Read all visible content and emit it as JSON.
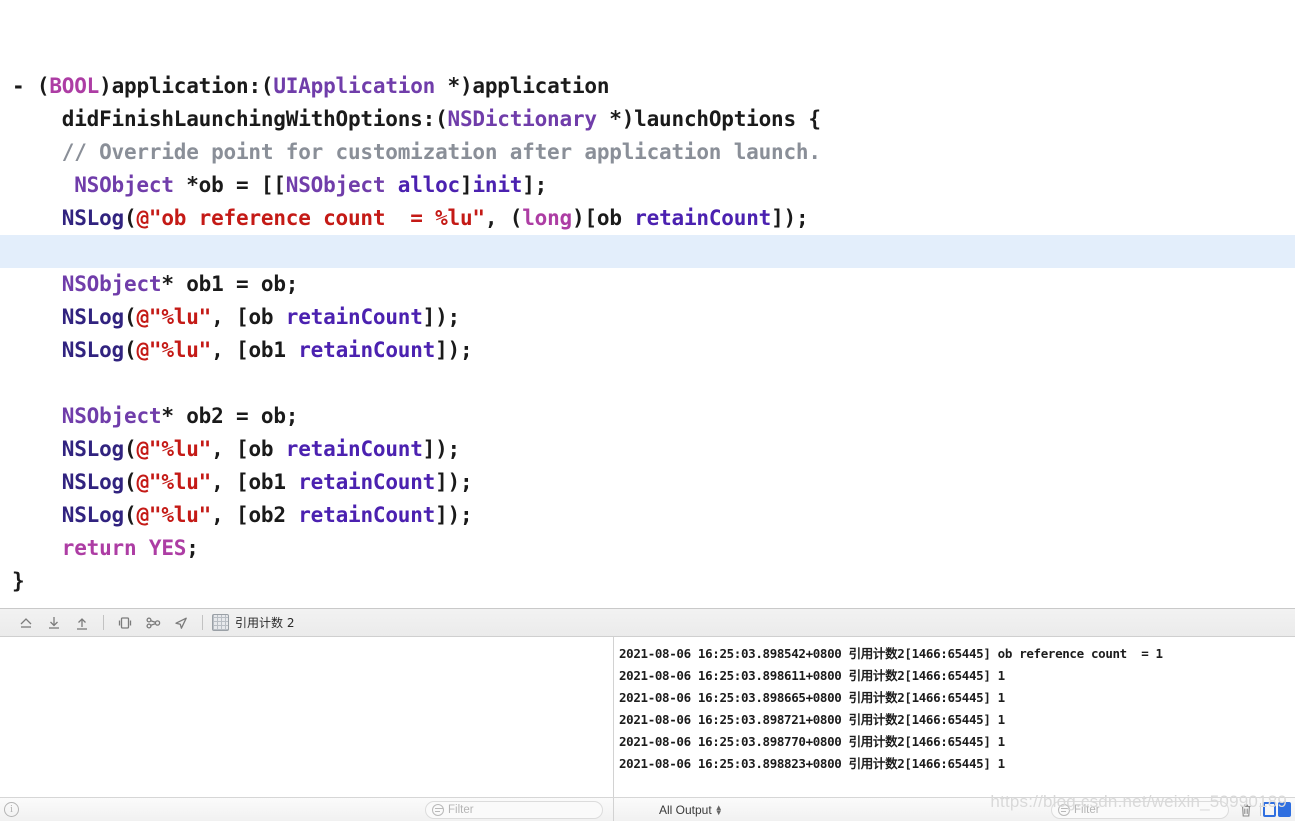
{
  "editor": {
    "lines": [
      {
        "highlight": false,
        "tokens": [
          {
            "t": "- ",
            "c": "pl"
          },
          {
            "t": "(",
            "c": "pl"
          },
          {
            "t": "BOOL",
            "c": "kw"
          },
          {
            "t": ")application:(",
            "c": "pl"
          },
          {
            "t": "UIApplication",
            "c": "type"
          },
          {
            "t": " *)application",
            "c": "pl"
          }
        ]
      },
      {
        "highlight": false,
        "tokens": [
          {
            "t": "    didFinishLaunchingWithOptions:(",
            "c": "pl"
          },
          {
            "t": "NSDictionary",
            "c": "type"
          },
          {
            "t": " *)launchOptions {",
            "c": "pl"
          }
        ]
      },
      {
        "highlight": false,
        "tokens": [
          {
            "t": "    // Override point for customization after application launch.",
            "c": "cmt"
          }
        ]
      },
      {
        "highlight": false,
        "tokens": [
          {
            "t": "     ",
            "c": "pl"
          },
          {
            "t": "NSObject",
            "c": "type"
          },
          {
            "t": " *ob = [[",
            "c": "pl"
          },
          {
            "t": "NSObject",
            "c": "type"
          },
          {
            "t": " ",
            "c": "pl"
          },
          {
            "t": "alloc",
            "c": "meth"
          },
          {
            "t": "]",
            "c": "pl"
          },
          {
            "t": "init",
            "c": "meth"
          },
          {
            "t": "];",
            "c": "pl"
          }
        ]
      },
      {
        "highlight": false,
        "tokens": [
          {
            "t": "    ",
            "c": "pl"
          },
          {
            "t": "NSLog",
            "c": "fn"
          },
          {
            "t": "(",
            "c": "pl"
          },
          {
            "t": "@\"ob reference count  = %lu\"",
            "c": "str"
          },
          {
            "t": ", (",
            "c": "pl"
          },
          {
            "t": "long",
            "c": "kw"
          },
          {
            "t": ")[ob ",
            "c": "pl"
          },
          {
            "t": "retainCount",
            "c": "meth"
          },
          {
            "t": "]);",
            "c": "pl"
          }
        ]
      },
      {
        "highlight": true,
        "tokens": []
      },
      {
        "highlight": false,
        "tokens": [
          {
            "t": "    ",
            "c": "pl"
          },
          {
            "t": "NSObject",
            "c": "type"
          },
          {
            "t": "* ob1 = ob;",
            "c": "pl"
          }
        ]
      },
      {
        "highlight": false,
        "tokens": [
          {
            "t": "    ",
            "c": "pl"
          },
          {
            "t": "NSLog",
            "c": "fn"
          },
          {
            "t": "(",
            "c": "pl"
          },
          {
            "t": "@\"%lu\"",
            "c": "str"
          },
          {
            "t": ", [ob ",
            "c": "pl"
          },
          {
            "t": "retainCount",
            "c": "meth"
          },
          {
            "t": "]);",
            "c": "pl"
          }
        ]
      },
      {
        "highlight": false,
        "tokens": [
          {
            "t": "    ",
            "c": "pl"
          },
          {
            "t": "NSLog",
            "c": "fn"
          },
          {
            "t": "(",
            "c": "pl"
          },
          {
            "t": "@\"%lu\"",
            "c": "str"
          },
          {
            "t": ", [ob1 ",
            "c": "pl"
          },
          {
            "t": "retainCount",
            "c": "meth"
          },
          {
            "t": "]);",
            "c": "pl"
          }
        ]
      },
      {
        "highlight": false,
        "tokens": []
      },
      {
        "highlight": false,
        "tokens": [
          {
            "t": "    ",
            "c": "pl"
          },
          {
            "t": "NSObject",
            "c": "type"
          },
          {
            "t": "* ob2 = ob;",
            "c": "pl"
          }
        ]
      },
      {
        "highlight": false,
        "tokens": [
          {
            "t": "    ",
            "c": "pl"
          },
          {
            "t": "NSLog",
            "c": "fn"
          },
          {
            "t": "(",
            "c": "pl"
          },
          {
            "t": "@\"%lu\"",
            "c": "str"
          },
          {
            "t": ", [ob ",
            "c": "pl"
          },
          {
            "t": "retainCount",
            "c": "meth"
          },
          {
            "t": "]);",
            "c": "pl"
          }
        ]
      },
      {
        "highlight": false,
        "tokens": [
          {
            "t": "    ",
            "c": "pl"
          },
          {
            "t": "NSLog",
            "c": "fn"
          },
          {
            "t": "(",
            "c": "pl"
          },
          {
            "t": "@\"%lu\"",
            "c": "str"
          },
          {
            "t": ", [ob1 ",
            "c": "pl"
          },
          {
            "t": "retainCount",
            "c": "meth"
          },
          {
            "t": "]);",
            "c": "pl"
          }
        ]
      },
      {
        "highlight": false,
        "tokens": [
          {
            "t": "    ",
            "c": "pl"
          },
          {
            "t": "NSLog",
            "c": "fn"
          },
          {
            "t": "(",
            "c": "pl"
          },
          {
            "t": "@\"%lu\"",
            "c": "str"
          },
          {
            "t": ", [ob2 ",
            "c": "pl"
          },
          {
            "t": "retainCount",
            "c": "meth"
          },
          {
            "t": "]);",
            "c": "pl"
          }
        ]
      },
      {
        "highlight": false,
        "tokens": [
          {
            "t": "    ",
            "c": "pl"
          },
          {
            "t": "return",
            "c": "kw"
          },
          {
            "t": " ",
            "c": "pl"
          },
          {
            "t": "YES",
            "c": "kw"
          },
          {
            "t": ";",
            "c": "pl"
          }
        ]
      },
      {
        "highlight": false,
        "tokens": [
          {
            "t": "}",
            "c": "pl"
          }
        ]
      }
    ],
    "colors": {
      "keyword": "#ad3da4",
      "type": "#703daa",
      "method": "#4b21b0",
      "function": "#31237f",
      "string": "#c41a16",
      "comment": "#8a8f98",
      "plain": "#1a1a1a",
      "current_line_highlight": "#e3eefb"
    }
  },
  "debug_toolbar": {
    "buttons": [
      {
        "name": "hide-debug-area",
        "icon": "home-arrow-icon",
        "label": ""
      },
      {
        "name": "step-into",
        "icon": "download-arrow-icon",
        "label": ""
      },
      {
        "name": "step-out",
        "icon": "upload-arrow-icon",
        "label": ""
      },
      {
        "name": "view-hierarchy",
        "icon": "view-debug-icon",
        "label": ""
      },
      {
        "name": "memory-graph",
        "icon": "memory-graph-icon",
        "label": ""
      },
      {
        "name": "simulate-location",
        "icon": "location-arrow-icon",
        "label": ""
      }
    ],
    "breadcrumb": {
      "icon": "app-grid-icon",
      "label": "引用计数 2"
    }
  },
  "console": {
    "lines": [
      "2021-08-06 16:25:03.898542+0800 引用计数2[1466:65445] ob reference count  = 1",
      "2021-08-06 16:25:03.898611+0800 引用计数2[1466:65445] 1",
      "2021-08-06 16:25:03.898665+0800 引用计数2[1466:65445] 1",
      "2021-08-06 16:25:03.898721+0800 引用计数2[1466:65445] 1",
      "2021-08-06 16:25:03.898770+0800 引用计数2[1466:65445] 1",
      "2021-08-06 16:25:03.898823+0800 引用计数2[1466:65445] 1"
    ]
  },
  "status_bar": {
    "info_icon": "i",
    "variables_filter_placeholder": "Filter",
    "console_filter_placeholder": "Filter",
    "output_scope": "All Output",
    "trash_icon": "trash-icon",
    "accent_color": "#2f6fe0"
  },
  "watermark": {
    "text": "https://blog.csdn.net/weixin_50990189"
  }
}
